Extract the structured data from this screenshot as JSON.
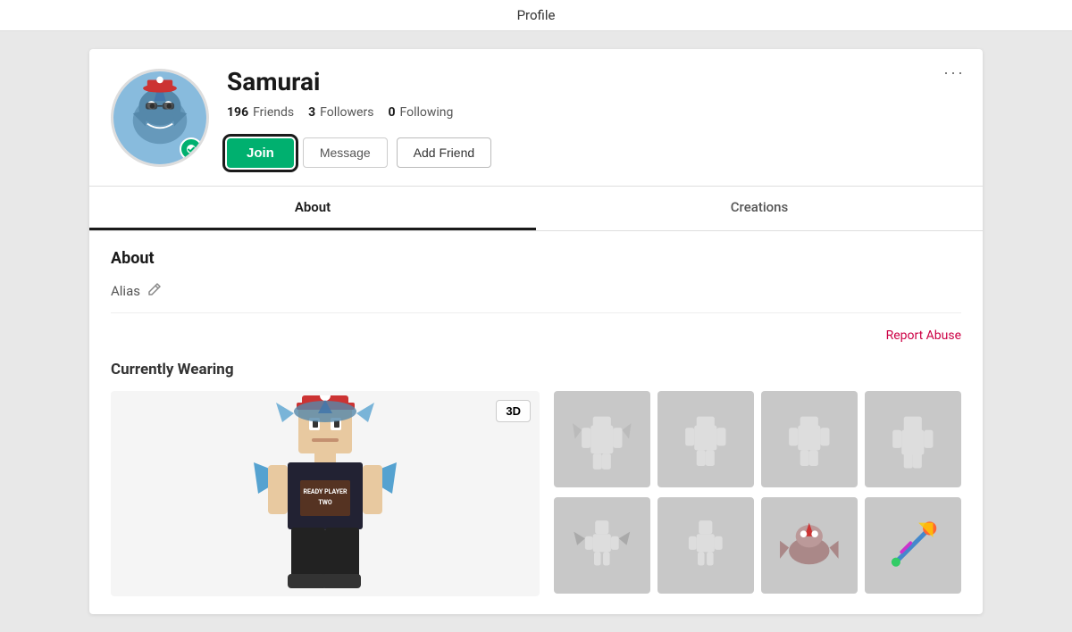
{
  "page": {
    "title": "Profile"
  },
  "profile": {
    "username": "Samurai",
    "friends_count": "196",
    "friends_label": "Friends",
    "followers_count": "3",
    "followers_label": "Followers",
    "following_count": "0",
    "following_label": "Following"
  },
  "actions": {
    "join_label": "Join",
    "message_label": "Message",
    "add_friend_label": "Add Friend",
    "more_options": "···"
  },
  "tabs": [
    {
      "id": "about",
      "label": "About",
      "active": true
    },
    {
      "id": "creations",
      "label": "Creations",
      "active": false
    }
  ],
  "about": {
    "section_title": "About",
    "alias_label": "Alias",
    "report_abuse": "Report Abuse"
  },
  "wearing": {
    "title": "Currently Wearing",
    "btn_3d": "3D",
    "items": [
      {
        "id": 1,
        "type": "outfit"
      },
      {
        "id": 2,
        "type": "shirt"
      },
      {
        "id": 3,
        "type": "pants"
      },
      {
        "id": 4,
        "type": "accessory"
      },
      {
        "id": 5,
        "type": "hat"
      },
      {
        "id": 6,
        "type": "face"
      },
      {
        "id": 7,
        "type": "gear"
      },
      {
        "id": 8,
        "type": "back"
      }
    ]
  },
  "colors": {
    "join_btn_bg": "#00b06f",
    "active_tab_border": "#1a1a1a",
    "report_abuse": "#cc0044"
  }
}
